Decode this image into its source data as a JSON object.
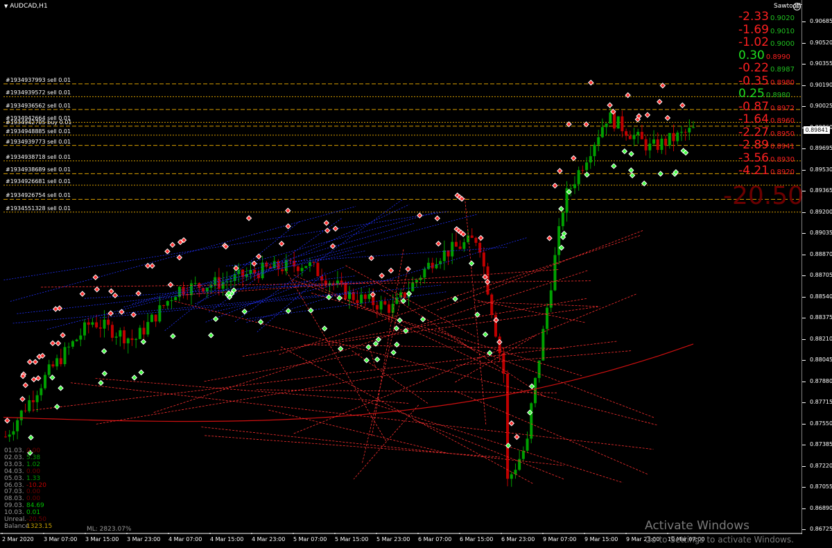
{
  "window": {
    "symbol": "AUDCAD,H1",
    "ea_name": "Sawtooth",
    "ea_icon": "smiley-icon"
  },
  "price_axis": {
    "ticks": [
      "0.90685",
      "0.90520",
      "0.90355",
      "0.90190",
      "0.90025",
      "0.89860",
      "0.89695",
      "0.89530",
      "0.89365",
      "0.89200",
      "0.89035",
      "0.88870",
      "0.88705",
      "0.88540",
      "0.88375",
      "0.88210",
      "0.88045",
      "0.87880",
      "0.87715",
      "0.87550",
      "0.87385",
      "0.87220",
      "0.87055",
      "0.86890",
      "0.86725"
    ],
    "current_price": "0.89841"
  },
  "time_axis": {
    "ticks": [
      "2 Mar 2020",
      "3 Mar 07:00",
      "3 Mar 15:00",
      "3 Mar 23:00",
      "4 Mar 07:00",
      "4 Mar 15:00",
      "4 Mar 23:00",
      "5 Mar 07:00",
      "5 Mar 15:00",
      "5 Mar 23:00",
      "6 Mar 07:00",
      "6 Mar 15:00",
      "6 Mar 23:00",
      "9 Mar 07:00",
      "9 Mar 15:00",
      "9 Mar 23:00",
      "10 Mar 07:00"
    ]
  },
  "order_labels": [
    "#1934937993 sell 0.01",
    "#1934939572 sell 0.01",
    "#1934936562 sell 0.01",
    "#1934942664 sell 0.01",
    "#1934942705 buy 0.01",
    "#1934948885 sell 0.01",
    "#1934939773 sell 0.01",
    "#1934938718 sell 0.01",
    "#1934938689 sell 0.01",
    "#1934926681 sell 0.01",
    "#1934926754 sell 0.01",
    "#1934551328 sell 0.01"
  ],
  "pnl_levels": [
    {
      "pnl": "-2.33",
      "price": "0.9020",
      "pnl_color": "#ff2020",
      "price_color": "#20c020"
    },
    {
      "pnl": "-1.69",
      "price": "0.9010",
      "pnl_color": "#ff2020",
      "price_color": "#20c020"
    },
    {
      "pnl": "-1.02",
      "price": "0.9000",
      "pnl_color": "#ff2020",
      "price_color": "#20c020"
    },
    {
      "pnl": "0.30",
      "price": "0.8990",
      "pnl_color": "#20e020",
      "price_color": "#ff2020"
    },
    {
      "pnl": "-0.22",
      "price": "0.8987",
      "pnl_color": "#ff2020",
      "price_color": "#20c020"
    },
    {
      "pnl": "-0.35",
      "price": "0.8980",
      "pnl_color": "#ff2020",
      "price_color": "#ff2020"
    },
    {
      "pnl": "0.25",
      "price": "0.8980",
      "pnl_color": "#20e020",
      "price_color": "#20c020"
    },
    {
      "pnl": "-0.87",
      "price": "0.8972",
      "pnl_color": "#ff2020",
      "price_color": "#ff2020"
    },
    {
      "pnl": "-1.64",
      "price": "0.8960",
      "pnl_color": "#ff2020",
      "price_color": "#ff2020"
    },
    {
      "pnl": "-2.27",
      "price": "0.8950",
      "pnl_color": "#ff2020",
      "price_color": "#ff2020"
    },
    {
      "pnl": "-2.89",
      "price": "0.8941",
      "pnl_color": "#ff2020",
      "price_color": "#ff2020"
    },
    {
      "pnl": "-3.56",
      "price": "0.8930",
      "pnl_color": "#ff2020",
      "price_color": "#ff2020"
    },
    {
      "pnl": "-4.21",
      "price": "0.8920",
      "pnl_color": "#ff2020",
      "price_color": "#ff2020"
    }
  ],
  "total_floating": "-20.50",
  "daily_history": [
    {
      "date": "01.03.",
      "value": "0.00",
      "color": "#6b0000"
    },
    {
      "date": "02.03.",
      "value": "5.38",
      "color": "#00a000"
    },
    {
      "date": "03.03.",
      "value": "1.02",
      "color": "#00a000"
    },
    {
      "date": "04.03.",
      "value": "0.00",
      "color": "#6b0000"
    },
    {
      "date": "05.03.",
      "value": "1.33",
      "color": "#00a000"
    },
    {
      "date": "06.03.",
      "value": "-10.20",
      "color": "#c00000"
    },
    {
      "date": "07.03.",
      "value": "0.00",
      "color": "#6b0000"
    },
    {
      "date": "08.03.",
      "value": "0.00",
      "color": "#6b0000"
    },
    {
      "date": "09.03.",
      "value": "84.69",
      "color": "#00c000"
    },
    {
      "date": "10.03.",
      "value": "0.01",
      "color": "#00c000"
    },
    {
      "date": "Unreal.",
      "value": "-20.50",
      "color": "#6b0000"
    },
    {
      "date": "Balance",
      "value": "1323.15",
      "color": "#c8a000"
    }
  ],
  "margin_level": "ML: 2823.07%",
  "watermark": {
    "title": "Activate Windows",
    "subtitle": "Go to Settings to activate Windows."
  },
  "colors": {
    "background": "#000000",
    "bull_candle": "#00a000",
    "bear_candle": "#c00000",
    "order_line": "#d9a000",
    "sell_marker": "#ff3030",
    "buy_marker": "#40ff40",
    "moving_average": "#d01010",
    "blue_trades": "#2030ff"
  },
  "chart_data": {
    "type": "candlestick",
    "title": "AUDCAD,H1",
    "ylim": [
      0.867,
      0.908
    ],
    "x_categories": [
      "2 Mar 2020",
      "3 Mar 07:00",
      "3 Mar 15:00",
      "3 Mar 23:00",
      "4 Mar 07:00",
      "4 Mar 15:00",
      "4 Mar 23:00",
      "5 Mar 07:00",
      "5 Mar 15:00",
      "5 Mar 23:00",
      "6 Mar 07:00",
      "6 Mar 15:00",
      "6 Mar 23:00",
      "9 Mar 07:00",
      "9 Mar 15:00",
      "9 Mar 23:00",
      "10 Mar 07:00"
    ],
    "close_approx": [
      0.8745,
      0.8795,
      0.8835,
      0.882,
      0.886,
      0.8865,
      0.8875,
      0.888,
      0.8855,
      0.8845,
      0.8885,
      0.89,
      0.872,
      0.893,
      0.8995,
      0.897,
      0.8984
    ],
    "order_levels": [
      0.902,
      0.901,
      0.9,
      0.899,
      0.8987,
      0.898,
      0.8972,
      0.896,
      0.895,
      0.8941,
      0.893,
      0.892
    ],
    "grid": false
  }
}
